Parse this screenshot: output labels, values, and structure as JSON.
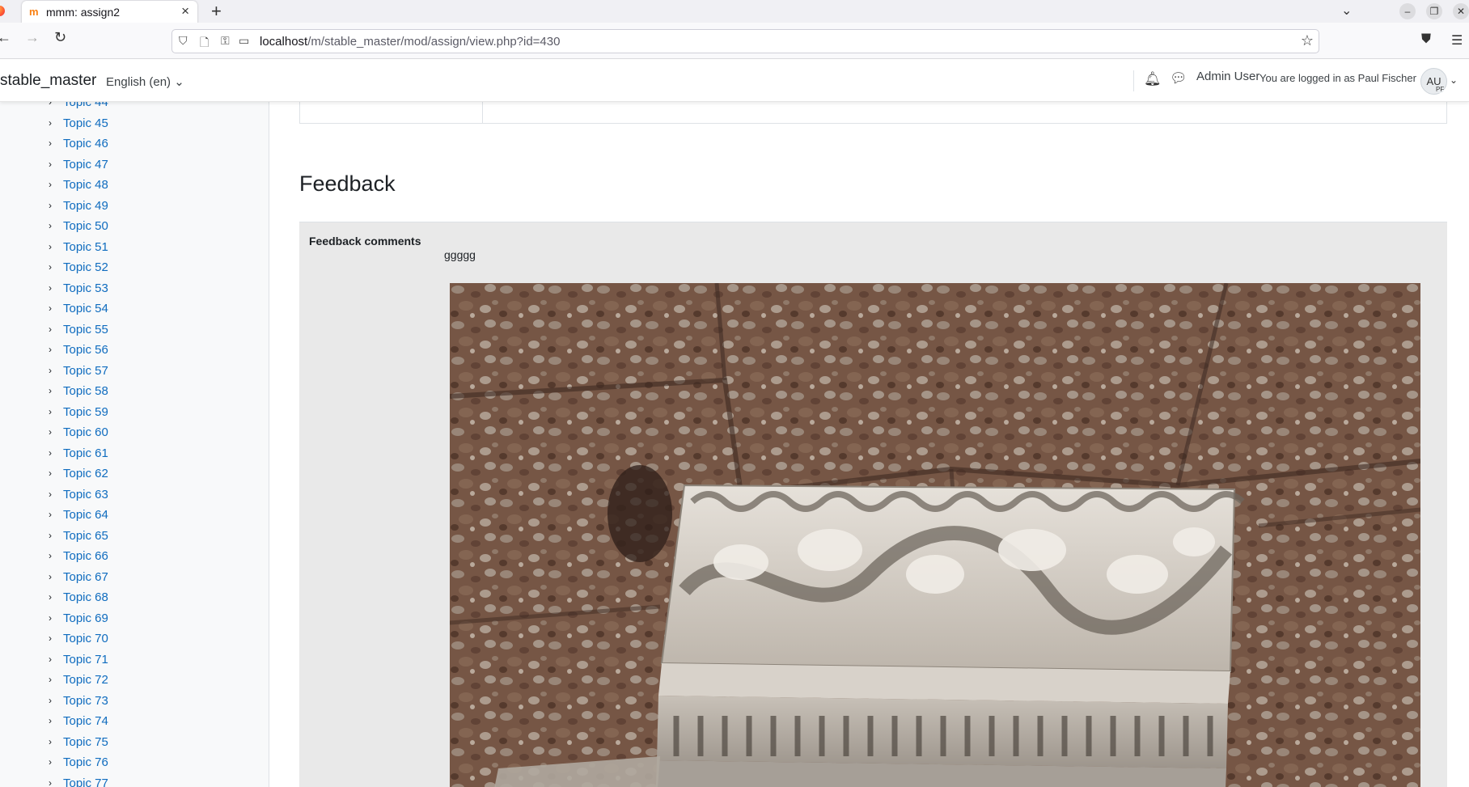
{
  "browser": {
    "tab_title": "mmm: assign2",
    "url_host": "localhost",
    "url_path": "/m/stable_master/mod/assign/view.php?id=430"
  },
  "header": {
    "site_name": "stable_master",
    "language": "English (en)",
    "user_name": "Admin User",
    "logged_in_as": "You are logged in as Paul Fischer",
    "avatar_initials": "AU",
    "avatar_sub_initials": "PF"
  },
  "drawer": {
    "topics": [
      "Topic 44",
      "Topic 45",
      "Topic 46",
      "Topic 47",
      "Topic 48",
      "Topic 49",
      "Topic 50",
      "Topic 51",
      "Topic 52",
      "Topic 53",
      "Topic 54",
      "Topic 55",
      "Topic 56",
      "Topic 57",
      "Topic 58",
      "Topic 59",
      "Topic 60",
      "Topic 61",
      "Topic 62",
      "Topic 63",
      "Topic 64",
      "Topic 65",
      "Topic 66",
      "Topic 67",
      "Topic 68",
      "Topic 69",
      "Topic 70",
      "Topic 71",
      "Topic 72",
      "Topic 73",
      "Topic 74",
      "Topic 75",
      "Topic 76",
      "Topic 77"
    ]
  },
  "main": {
    "feedback_heading": "Feedback",
    "feedback_label": "Feedback comments",
    "feedback_text": "ggggg",
    "image_subject": "carved-marble-frieze-against-conglomerate-wall"
  },
  "colors": {
    "link": "#0f6cbf",
    "feedback_bg": "#e9e9e9",
    "drawer_bg": "#f8f9fa"
  }
}
